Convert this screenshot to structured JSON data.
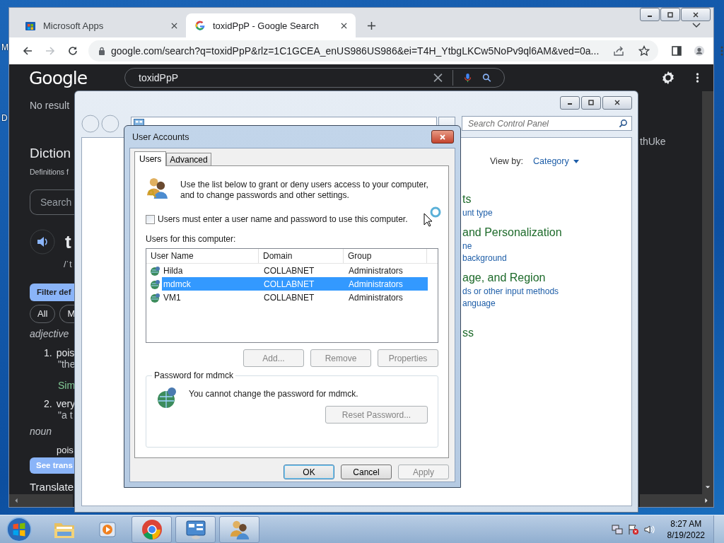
{
  "desktop": {
    "labels": [
      "M",
      "D"
    ]
  },
  "browser": {
    "tabs": [
      {
        "title": "Microsoft Apps",
        "kind": "store",
        "selected": false
      },
      {
        "title": "toxidPpP - Google Search",
        "kind": "google",
        "selected": true
      }
    ],
    "toolbar": {
      "forward_disabled": true,
      "url": "google.com/search?q=toxidPpP&rlz=1C1GCEA_enUS986US986&ei=T4H_YtbgLKCw5NoPv9ql6AM&ved=0a..."
    },
    "page": {
      "logo": "Google",
      "query": "toxidPpP",
      "left": [
        {
          "kind": "muted",
          "text": "No result"
        },
        {
          "kind": "heading",
          "text": "Diction"
        },
        {
          "kind": "small",
          "text": "Definitions f"
        },
        {
          "kind": "search",
          "text": "Search"
        },
        {
          "kind": "word",
          "text": "t"
        },
        {
          "kind": "phonetic",
          "text": "/ˈt"
        },
        {
          "kind": "filter",
          "text": "Filter def"
        },
        {
          "kind": "chips",
          "chips": [
            "All",
            "M"
          ]
        },
        {
          "kind": "pos",
          "text": "adjective"
        },
        {
          "kind": "numbered",
          "number": "1.",
          "text": "pois"
        },
        {
          "kind": "quote",
          "text": "\"the"
        },
        {
          "kind": "synonym",
          "text": "Sim"
        },
        {
          "kind": "numbered",
          "number": "2.",
          "text": "very"
        },
        {
          "kind": "quote",
          "text": "\"a t"
        },
        {
          "kind": "pos",
          "text": "noun"
        },
        {
          "kind": "indent",
          "text": "pois"
        },
        {
          "kind": "tooltip",
          "text": "See trans"
        },
        {
          "kind": "translate",
          "text": "Translate"
        }
      ],
      "right": [
        "thUke"
      ]
    }
  },
  "control_panel": {
    "search_placeholder": "Search Control Panel",
    "view_by": {
      "label": "View by:",
      "value": "Category"
    },
    "categories": [
      {
        "kind": "group",
        "text": "ts"
      },
      {
        "kind": "link",
        "text": "unt type"
      },
      {
        "kind": "group",
        "text": "and Personalization"
      },
      {
        "kind": "link",
        "text": "ne"
      },
      {
        "kind": "link",
        "text": "background"
      },
      {
        "kind": "group",
        "text": "age, and Region"
      },
      {
        "kind": "link",
        "text": "ds or other input methods"
      },
      {
        "kind": "link",
        "text": "anguage"
      },
      {
        "kind": "group",
        "text": "ss"
      }
    ]
  },
  "dialog": {
    "title": "User Accounts",
    "tabs": [
      {
        "label": "Users",
        "selected": true
      },
      {
        "label": "Advanced",
        "selected": false
      }
    ],
    "intro": "Use the list below to grant or deny users access to your computer, and to change passwords and other settings.",
    "require_login": {
      "label": "Users must enter a user name and password to use this computer.",
      "checked": false
    },
    "users_label": "Users for this computer:",
    "columns": [
      "User Name",
      "Domain",
      "Group"
    ],
    "rows": [
      {
        "name": "Hilda",
        "domain": "COLLABNET",
        "group": "Administrators",
        "selected": false
      },
      {
        "name": "mdmck",
        "domain": "COLLABNET",
        "group": "Administrators",
        "selected": true
      },
      {
        "name": "VM1",
        "domain": "COLLABNET",
        "group": "Administrators",
        "selected": false
      }
    ],
    "list_buttons": [
      {
        "label": "Add...",
        "disabled": true
      },
      {
        "label": "Remove",
        "disabled": true
      },
      {
        "label": "Properties",
        "disabled": true
      }
    ],
    "password": {
      "title": "Password for mdmck",
      "message": "You cannot change the password for mdmck.",
      "button": {
        "label": "Reset Password...",
        "disabled": true
      }
    },
    "buttons": [
      {
        "label": "OK",
        "default": true,
        "disabled": false
      },
      {
        "label": "Cancel",
        "default": false,
        "disabled": false
      },
      {
        "label": "Apply",
        "default": false,
        "disabled": true
      }
    ]
  },
  "taskbar": {
    "apps": [
      {
        "kind": "folder",
        "running": false
      },
      {
        "kind": "media",
        "running": false
      },
      {
        "kind": "chrome",
        "running": true
      },
      {
        "kind": "control-panel",
        "running": true
      },
      {
        "kind": "users",
        "running": true
      }
    ],
    "clock": {
      "time": "8:27 AM",
      "date": "8/19/2022"
    }
  }
}
